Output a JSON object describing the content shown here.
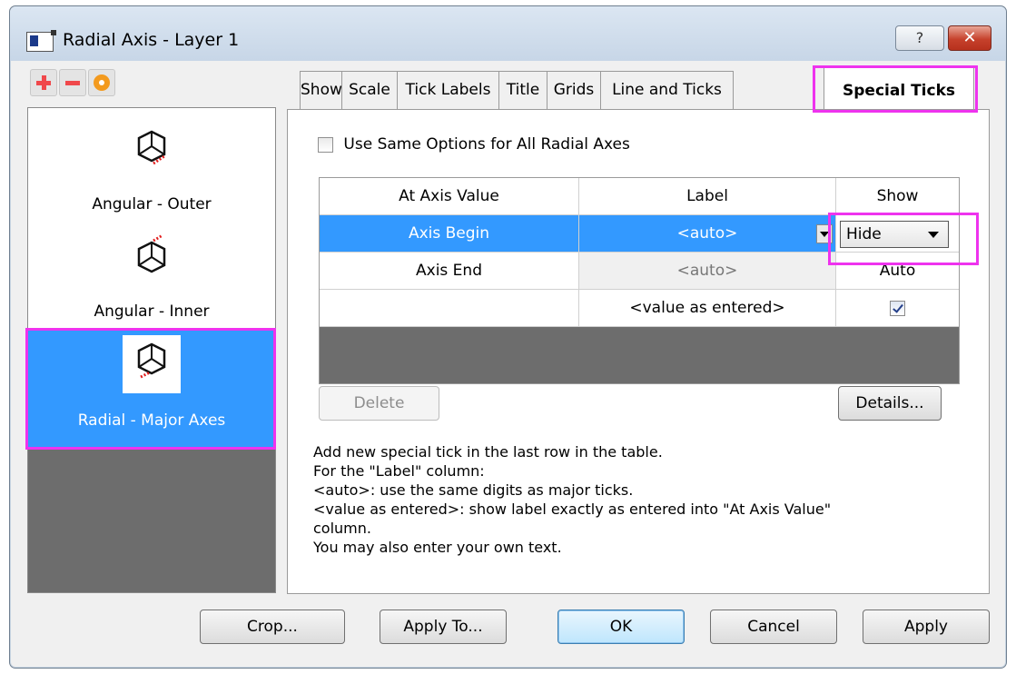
{
  "window": {
    "title": "Radial Axis - Layer 1",
    "help_label": "?",
    "close_label": "✕"
  },
  "axis_list": {
    "items": [
      {
        "label": "Angular - Outer",
        "icon": "cube-outer-axis-icon",
        "selected": false
      },
      {
        "label": "Angular - Inner",
        "icon": "cube-inner-axis-icon",
        "selected": false
      },
      {
        "label": "Radial - Major Axes",
        "icon": "cube-radial-axis-icon",
        "selected": true
      }
    ]
  },
  "tabs": [
    {
      "label": "Show"
    },
    {
      "label": "Scale"
    },
    {
      "label": "Tick Labels"
    },
    {
      "label": "Title"
    },
    {
      "label": "Grids"
    },
    {
      "label": "Line and Ticks"
    },
    {
      "label": "Special Ticks",
      "active": true
    }
  ],
  "panel": {
    "same_options_label": "Use Same Options for All Radial Axes",
    "table": {
      "headers": [
        "At Axis Value",
        "Label",
        "Show"
      ],
      "rows": [
        {
          "value": "Axis Begin",
          "label": "<auto>",
          "show": "Hide"
        },
        {
          "value": "Axis End",
          "label": "<auto>",
          "show": "Auto"
        },
        {
          "value": "",
          "label": "<value as entered>",
          "show_checked": true
        }
      ]
    },
    "delete_label": "Delete",
    "details_label": "Details...",
    "help_lines": [
      "Add new special tick in the last row in the table.",
      "For the \"Label\" column:",
      "<auto>: use the same digits as major ticks.",
      "<value as entered>: show label exactly as entered into \"At Axis Value\"",
      "column.",
      "You may also enter your own text."
    ]
  },
  "buttons": {
    "crop": "Crop...",
    "apply_to": "Apply To...",
    "ok": "OK",
    "cancel": "Cancel",
    "apply": "Apply"
  },
  "colors": {
    "selection": "#3399ff",
    "highlight": "#ee33ee",
    "close": "#c6412c"
  }
}
